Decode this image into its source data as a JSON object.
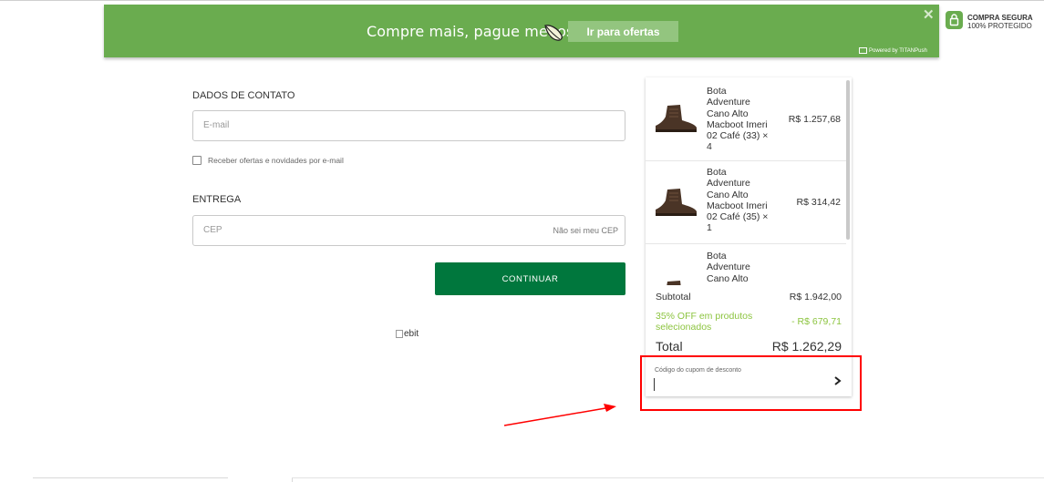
{
  "banner": {
    "text": "Compre mais, pague menos",
    "button": "Ir para ofertas",
    "close": "✕",
    "powered": "Powered by TITANPush"
  },
  "secure_badge": {
    "title": "COMPRA SEGURA",
    "subtitle": "100% PROTEGIDO"
  },
  "contact": {
    "title": "DADOS DE CONTATO",
    "email_placeholder": "E-mail",
    "newsletter_label": "Receber ofertas e novidades por e-mail"
  },
  "delivery": {
    "title": "ENTREGA",
    "cep_placeholder": "CEP",
    "cep_link": "Não sei meu CEP"
  },
  "continue_button": "CONTINUAR",
  "ebit_alt": "ebit",
  "cart": {
    "items": [
      {
        "name": "Bota Adventure Cano Alto Macboot Imeri 02 Café (33) × 4",
        "price": "R$ 1.257,68"
      },
      {
        "name": "Bota Adventure Cano Alto Macboot Imeri 02 Café (35) × 1",
        "price": "R$ 314,42"
      },
      {
        "name": "Bota Adventure Cano Alto",
        "price": ""
      }
    ],
    "subtotal_label": "Subtotal",
    "subtotal_value": "R$ 1.942,00",
    "discount_label": "35% OFF em produtos selecionados",
    "discount_value": "- R$ 679,71",
    "total_label": "Total",
    "total_value": "R$ 1.262,29",
    "coupon_label": "Código do cupom de desconto"
  },
  "colors": {
    "banner_green": "#6aac4f",
    "button_green": "#00773d",
    "discount_green": "#8cc43f",
    "annotation_red": "#ff0000"
  }
}
